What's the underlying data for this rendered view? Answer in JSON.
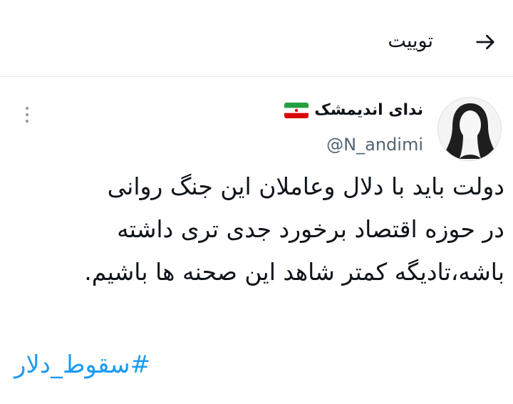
{
  "header": {
    "title": "توییت",
    "back_icon": "arrow-back-icon"
  },
  "tweet": {
    "author": {
      "display_name": "ندای اندیمشک",
      "flag_icon": "iran-flag-icon",
      "handle": "@N_andimi"
    },
    "more_icon": "more-vertical-icon",
    "text": "دولت باید با دلال وعاملان این جنگ روانی\nدر حوزه اقتصاد برخورد جدی تری داشته\nباشه،تادیگه کمتر شاهد این صحنه ها باشیم.",
    "hashtag": "#سقوط_دلار"
  },
  "colors": {
    "link": "#1d9bf0",
    "secondary_text": "#536471",
    "divider": "#e6ecf0"
  }
}
